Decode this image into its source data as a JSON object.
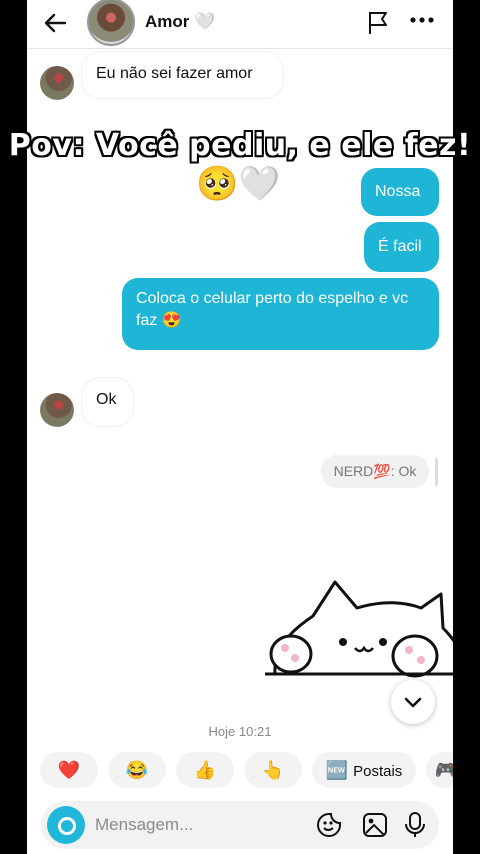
{
  "header": {
    "contact_name": "Amor 🤍"
  },
  "overlay": {
    "caption": "Pov: Você pediu, e ele fez!",
    "emojis": "🥺🤍"
  },
  "messages": [
    {
      "side": "in",
      "text": "Eu não sei fazer amor"
    },
    {
      "side": "out",
      "text": "Nossa"
    },
    {
      "side": "out",
      "text": "É facil"
    },
    {
      "side": "out",
      "text": "Coloca o celular perto do espelho e vc faz 😍"
    },
    {
      "side": "in",
      "text": "Ok"
    }
  ],
  "reply_preview": "NERD💯: Ok",
  "timestamp": "Hoje 10:21",
  "quick_reactions": [
    {
      "emoji": "❤️"
    },
    {
      "emoji": "😂"
    },
    {
      "emoji": "👍"
    },
    {
      "emoji": "👆"
    },
    {
      "emoji": "🆕",
      "label": "Postais"
    },
    {
      "emoji": "🎮"
    }
  ],
  "composer": {
    "placeholder": "Mensagem..."
  },
  "colors": {
    "outgoing_bubble": "#1eb5d6",
    "camera_button": "#21b7db"
  }
}
